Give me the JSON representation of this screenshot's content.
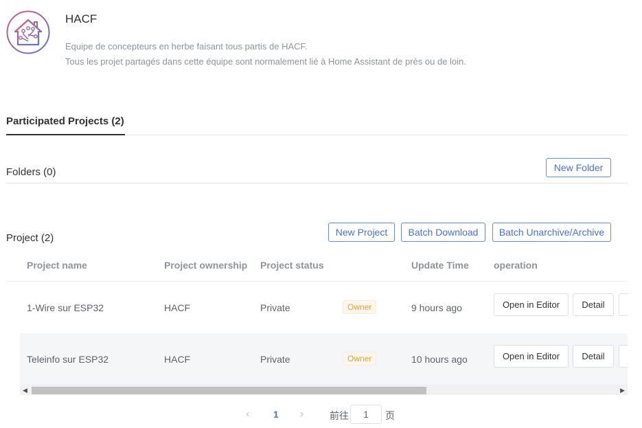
{
  "team": {
    "logo_icon": "home-assistant-circuit-logo",
    "name": "HACF",
    "description_lines": [
      "Equipe de concepteurs en herbe faisant tous partis de HACF.",
      "Tous les projet partagés dans cette équipe sont normalement lié à Home Assistant de près ou de loin."
    ]
  },
  "tabs": [
    {
      "label": "Participated Projects (2)",
      "active": true
    }
  ],
  "folders": {
    "title": "Folders (0)",
    "new_folder_label": "New Folder"
  },
  "projects": {
    "title": "Project (2)",
    "buttons": {
      "new_project": "New Project",
      "batch_download": "Batch Download",
      "batch_archive": "Batch Unarchive/Archive"
    },
    "columns": {
      "name": "Project name",
      "ownership": "Project ownership",
      "status": "Project status",
      "update_time": "Update Time",
      "operation": "operation"
    },
    "rows": [
      {
        "name": "1-Wire sur ESP32",
        "ownership": "HACF",
        "status": "Private",
        "role": "Owner",
        "update_time": "9 hours ago",
        "open_label": "Open in Editor",
        "detail_label": "Detail"
      },
      {
        "name": "Teleinfo sur ESP32",
        "ownership": "HACF",
        "status": "Private",
        "role": "Owner",
        "update_time": "10 hours ago",
        "open_label": "Open in Editor",
        "detail_label": "Detail"
      }
    ]
  },
  "pagination": {
    "current_page": "1",
    "goto_prefix": "前往",
    "goto_value": "1",
    "goto_suffix": "页"
  },
  "colors": {
    "accent": "#4c6ee0",
    "badge_text": "#e6a23c",
    "alt_row_bg": "#f5f6f7"
  }
}
